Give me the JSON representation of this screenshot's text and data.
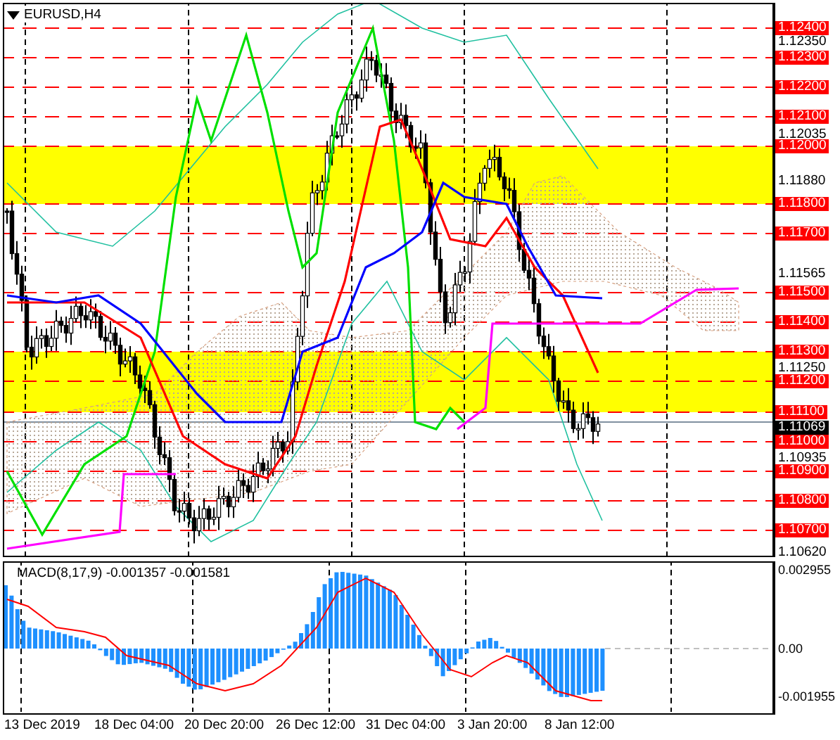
{
  "chart": {
    "symbol": "EURUSD,H4"
  },
  "price_levels": [
    "1.12400",
    "1.12300",
    "1.12200",
    "1.12100",
    "1.12000",
    "1.11800",
    "1.11700",
    "1.11500",
    "1.11400",
    "1.11300",
    "1.11200",
    "1.11100",
    "1.11000",
    "1.10900",
    "1.10800",
    "1.10700"
  ],
  "price_ticks": [
    "1.12350",
    "1.12035",
    "1.11880",
    "1.11565",
    "1.11250",
    "1.10935",
    "1.10620"
  ],
  "current_price": "1.11069",
  "macd": {
    "label": "MACD(8,17,9) -0.001357 -0.001581",
    "ticks": [
      "0.002955",
      "0.00",
      "-0.001955"
    ]
  },
  "time_labels": [
    "13 Dec 2019",
    "18 Dec 04:00",
    "20 Dec 20:00",
    "26 Dec 12:00",
    "31 Dec 04:00",
    "3 Jan 20:00",
    "8 Jan 12:00"
  ]
}
